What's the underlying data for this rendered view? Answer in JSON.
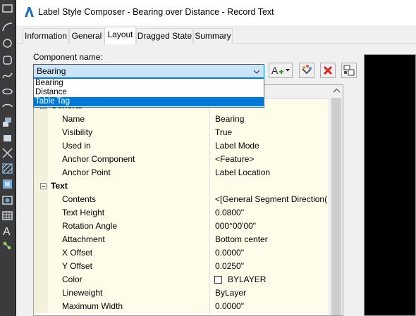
{
  "window": {
    "title": "Label Style Composer - Bearing over Distance - Record Text"
  },
  "tabs": [
    {
      "label": "Information"
    },
    {
      "label": "General"
    },
    {
      "label": "Layout"
    },
    {
      "label": "Dragged State"
    },
    {
      "label": "Summary"
    }
  ],
  "active_tab": "Layout",
  "component": {
    "label": "Component name:",
    "selected": "Bearing",
    "options": [
      {
        "label": "Bearing"
      },
      {
        "label": "Distance"
      },
      {
        "label": "Table Tag"
      }
    ],
    "highlighted_option": "Table Tag"
  },
  "toolbar": {
    "add_component_icon": "add-text-component-icon",
    "copy_component_icon": "copy-component-icon",
    "delete_component_icon": "delete-icon",
    "draw_order_icon": "draw-order-icon"
  },
  "properties": {
    "general_category": "General",
    "text_category": "Text",
    "rows": [
      {
        "name": "Name",
        "value": "Bearing"
      },
      {
        "name": "Visibility",
        "value": "True"
      },
      {
        "name": "Used in",
        "value": "Label Mode"
      },
      {
        "name": "Anchor Component",
        "value": "<Feature>"
      },
      {
        "name": "Anchor Point",
        "value": "Label Location"
      },
      {
        "name": "Contents",
        "value": "<[General Segment Direction(U..."
      },
      {
        "name": "Text Height",
        "value": "0.0800\""
      },
      {
        "name": "Rotation Angle",
        "value": "000°00'00\""
      },
      {
        "name": "Attachment",
        "value": "Bottom center"
      },
      {
        "name": "X Offset",
        "value": "0.0000\""
      },
      {
        "name": "Y Offset",
        "value": "0.0250\""
      },
      {
        "name": "Color",
        "value": "BYLAYER"
      },
      {
        "name": "Lineweight",
        "value": "ByLayer"
      },
      {
        "name": "Maximum Width",
        "value": "0.0000\""
      }
    ]
  },
  "colors": {
    "accent": "#0078d7",
    "grid_cell": "#fffdea",
    "grid_gutter": "#f3f0dc",
    "delete_red": "#e02020"
  }
}
